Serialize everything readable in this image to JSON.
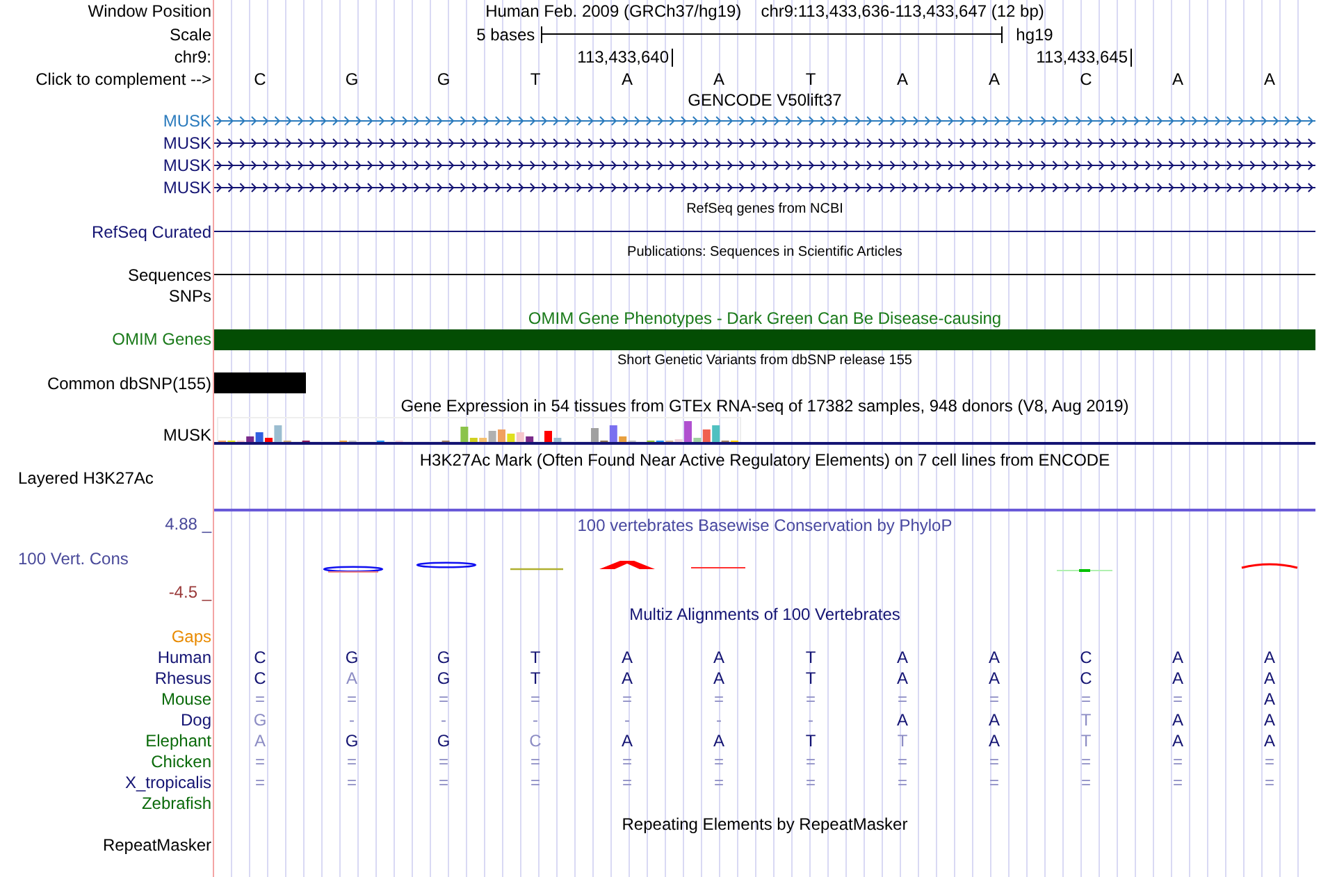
{
  "position": {
    "label": "Window Position",
    "assembly": "Human Feb. 2009 (GRCh37/hg19)",
    "range": "chr9:113,433,636-113,433,647 (12 bp)"
  },
  "scale": {
    "label": "Scale",
    "span": "5 bases",
    "assembly": "hg19"
  },
  "sequence": {
    "ruler_label": "chr9:",
    "complement_label": "Click to complement -->",
    "bases": [
      {
        "letter": "C"
      },
      {
        "letter": "G"
      },
      {
        "letter": "G"
      },
      {
        "letter": "T"
      },
      {
        "letter": "A",
        "tick": "113,433,640"
      },
      {
        "letter": "A"
      },
      {
        "letter": "T"
      },
      {
        "letter": "A"
      },
      {
        "letter": "A"
      },
      {
        "letter": "C",
        "tick": "113,433,645"
      },
      {
        "letter": "A"
      },
      {
        "letter": "A"
      }
    ]
  },
  "tracks": [
    {
      "kind": "genes",
      "title": "GENCODE V50lift37",
      "genes": [
        {
          "name": "MUSK",
          "color": "#2b7bbd"
        },
        {
          "name": "MUSK",
          "color": "#141473"
        },
        {
          "name": "MUSK",
          "color": "#141473"
        },
        {
          "name": "MUSK",
          "color": "#141473"
        }
      ]
    },
    {
      "kind": "line",
      "title": "RefSeq genes from NCBI",
      "label": "RefSeq Curated",
      "color": "#141473"
    },
    {
      "kind": "line",
      "title": "Publications: Sequences in Scientific Articles",
      "label": "Sequences",
      "color": "#000000"
    },
    {
      "kind": "empty",
      "label": "SNPs"
    },
    {
      "kind": "bar",
      "title": "OMIM Gene Phenotypes - Dark Green Can Be Disease-causing",
      "label": "OMIM Genes",
      "color": "#034d03"
    },
    {
      "kind": "variants",
      "title": "Short Genetic Variants from dbSNP release 155",
      "label": "Common dbSNP(155)"
    },
    {
      "kind": "expression",
      "title": "Gene Expression in 54 tissues from GTEx RNA-seq of 17382 samples, 948 donors (V8, Aug 2019)",
      "label": "MUSK"
    },
    {
      "kind": "signal",
      "title": "H3K27Ac Mark (Often Found Near Active Regulatory Elements) on 7 cell lines from ENCODE",
      "label": "Layered H3K27Ac"
    },
    {
      "kind": "conservation",
      "title": "100 vertebrates Basewise Conservation by PhyloP",
      "label": "100 Vert. Cons",
      "max": "4.88 _",
      "min": "-4.5 _"
    },
    {
      "kind": "alignment",
      "title": "Multiz Alignments of 100 Vertebrates",
      "gaps_label": "Gaps",
      "species": [
        {
          "name": "Human",
          "color": "#141473",
          "bases": [
            {
              "base": "C",
              "faded": false
            },
            {
              "base": "G",
              "faded": false
            },
            {
              "base": "G",
              "faded": false
            },
            {
              "base": "T",
              "faded": false
            },
            {
              "base": "A",
              "faded": false
            },
            {
              "base": "A",
              "faded": false
            },
            {
              "base": "T",
              "faded": false
            },
            {
              "base": "A",
              "faded": false
            },
            {
              "base": "A",
              "faded": false
            },
            {
              "base": "C",
              "faded": false
            },
            {
              "base": "A",
              "faded": false
            },
            {
              "base": "A",
              "faded": false
            }
          ]
        },
        {
          "name": "Rhesus",
          "color": "#141473",
          "bases": [
            {
              "base": "C",
              "faded": false
            },
            {
              "base": "A",
              "faded": true
            },
            {
              "base": "G",
              "faded": false
            },
            {
              "base": "T",
              "faded": false
            },
            {
              "base": "A",
              "faded": false
            },
            {
              "base": "A",
              "faded": false
            },
            {
              "base": "T",
              "faded": false
            },
            {
              "base": "A",
              "faded": false
            },
            {
              "base": "A",
              "faded": false
            },
            {
              "base": "C",
              "faded": false
            },
            {
              "base": "A",
              "faded": false
            },
            {
              "base": "A",
              "faded": false
            }
          ]
        },
        {
          "name": "Mouse",
          "color": "#0a6a0a",
          "bases": [
            {
              "base": "=",
              "faded": true
            },
            {
              "base": "=",
              "faded": true
            },
            {
              "base": "=",
              "faded": true
            },
            {
              "base": "=",
              "faded": true
            },
            {
              "base": "=",
              "faded": true
            },
            {
              "base": "=",
              "faded": true
            },
            {
              "base": "=",
              "faded": true
            },
            {
              "base": "=",
              "faded": true
            },
            {
              "base": "=",
              "faded": true
            },
            {
              "base": "=",
              "faded": true
            },
            {
              "base": "=",
              "faded": true
            },
            {
              "base": "A",
              "faded": false
            }
          ]
        },
        {
          "name": "Dog",
          "color": "#141473",
          "bases": [
            {
              "base": "G",
              "faded": true
            },
            {
              "base": "-",
              "faded": true
            },
            {
              "base": "-",
              "faded": true
            },
            {
              "base": "-",
              "faded": true
            },
            {
              "base": "-",
              "faded": true
            },
            {
              "base": "-",
              "faded": true
            },
            {
              "base": "-",
              "faded": true
            },
            {
              "base": "A",
              "faded": false
            },
            {
              "base": "A",
              "faded": false
            },
            {
              "base": "T",
              "faded": true
            },
            {
              "base": "A",
              "faded": false
            },
            {
              "base": "A",
              "faded": false
            }
          ]
        },
        {
          "name": "Elephant",
          "color": "#0a6a0a",
          "bases": [
            {
              "base": "A",
              "faded": true
            },
            {
              "base": "G",
              "faded": false
            },
            {
              "base": "G",
              "faded": false
            },
            {
              "base": "C",
              "faded": true
            },
            {
              "base": "A",
              "faded": false
            },
            {
              "base": "A",
              "faded": false
            },
            {
              "base": "T",
              "faded": false
            },
            {
              "base": "T",
              "faded": true
            },
            {
              "base": "A",
              "faded": false
            },
            {
              "base": "T",
              "faded": true
            },
            {
              "base": "A",
              "faded": false
            },
            {
              "base": "A",
              "faded": false
            }
          ]
        },
        {
          "name": "Chicken",
          "color": "#0a6a0a",
          "bases": [
            {
              "base": "=",
              "faded": true
            },
            {
              "base": "=",
              "faded": true
            },
            {
              "base": "=",
              "faded": true
            },
            {
              "base": "=",
              "faded": true
            },
            {
              "base": "=",
              "faded": true
            },
            {
              "base": "=",
              "faded": true
            },
            {
              "base": "=",
              "faded": true
            },
            {
              "base": "=",
              "faded": true
            },
            {
              "base": "=",
              "faded": true
            },
            {
              "base": "=",
              "faded": true
            },
            {
              "base": "=",
              "faded": true
            },
            {
              "base": "=",
              "faded": true
            }
          ]
        },
        {
          "name": "X_tropicalis",
          "color": "#141473",
          "bases": [
            {
              "base": "=",
              "faded": true
            },
            {
              "base": "=",
              "faded": true
            },
            {
              "base": "=",
              "faded": true
            },
            {
              "base": "=",
              "faded": true
            },
            {
              "base": "=",
              "faded": true
            },
            {
              "base": "=",
              "faded": true
            },
            {
              "base": "=",
              "faded": true
            },
            {
              "base": "=",
              "faded": true
            },
            {
              "base": "=",
              "faded": true
            },
            {
              "base": "=",
              "faded": true
            },
            {
              "base": "=",
              "faded": true
            },
            {
              "base": "=",
              "faded": true
            }
          ]
        },
        {
          "name": "Zebrafish",
          "color": "#0a6a0a"
        }
      ]
    },
    {
      "kind": "repeats",
      "title": "Repeating Elements by RepeatMasker",
      "label": "RepeatMasker"
    }
  ]
}
